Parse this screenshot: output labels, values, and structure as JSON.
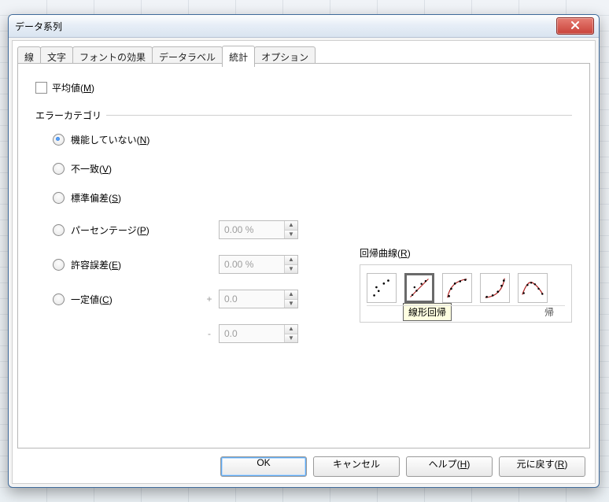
{
  "window": {
    "title": "データ系列"
  },
  "tabs": [
    "線",
    "文字",
    "フォントの効果",
    "データラベル",
    "統計",
    "オプション"
  ],
  "content": {
    "mean_label": "平均値",
    "mean_key": "M",
    "error_category": "エラーカテゴリ",
    "radios": [
      {
        "label": "機能していない",
        "key": "N"
      },
      {
        "label": "不一致",
        "key": "V"
      },
      {
        "label": "標準偏差",
        "key": "S"
      },
      {
        "label": "パーセンテージ",
        "key": "P"
      },
      {
        "label": "許容誤差",
        "key": "E"
      },
      {
        "label": "一定値",
        "key": "C"
      }
    ],
    "spin_percent": "0.00 %",
    "spin_margin": "0.00 %",
    "spin_const1": "0.0",
    "spin_const2": "0.0",
    "plus": "+",
    "minus": "-",
    "regression_label": "回帰曲線",
    "regression_key": "R",
    "tooltip": "線形回帰",
    "regression_caption": "帰"
  },
  "buttons": {
    "ok": "OK",
    "cancel": "キャンセル",
    "help_label": "ヘルプ",
    "help_key": "H",
    "reset_label": "元に戻す",
    "reset_key": "R"
  }
}
